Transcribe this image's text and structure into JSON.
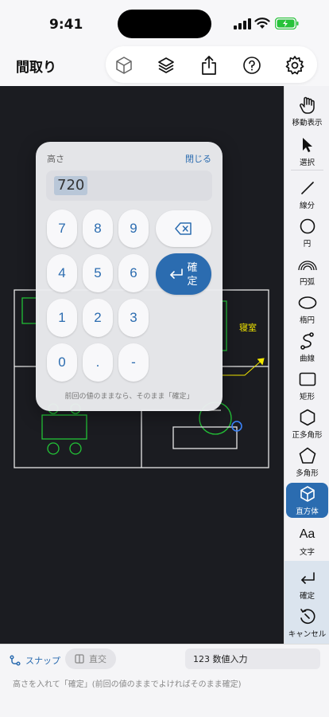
{
  "status": {
    "time": "9:41"
  },
  "header": {
    "title": "間取り"
  },
  "toolbar": [
    "cube-icon",
    "layers-icon",
    "share-icon",
    "help-icon",
    "settings-icon"
  ],
  "canvas": {
    "room_label": "寝室",
    "accent": "#f2e600"
  },
  "tools": {
    "move": "移動表示",
    "select": "選択",
    "line": "線分",
    "circle": "円",
    "arc": "円弧",
    "ellipse": "楕円",
    "curve": "曲線",
    "rect": "矩形",
    "polygon_regular": "正多角形",
    "polygon": "多角形",
    "cuboid": "直方体",
    "text": "文字",
    "text_icon": "Aa",
    "confirm": "確定",
    "cancel": "キャンセル"
  },
  "calculator": {
    "title": "高さ",
    "close": "閉じる",
    "value": "720",
    "keys": [
      "7",
      "8",
      "9",
      "4",
      "5",
      "6",
      "1",
      "2",
      "3",
      "0",
      ".",
      "-"
    ],
    "confirm": "確定",
    "hint": "前回の値のままなら、そのまま「確定」"
  },
  "bottom": {
    "snap": "スナップ",
    "ortho": "直交",
    "numeric": "123  数値入力",
    "hint": "高さを入れて「確定」(前回の値のままでよければそのまま確定)"
  },
  "colors": {
    "accent": "#2b6cb0",
    "canvas_bg": "#1b1c21",
    "green": "#23c437"
  }
}
